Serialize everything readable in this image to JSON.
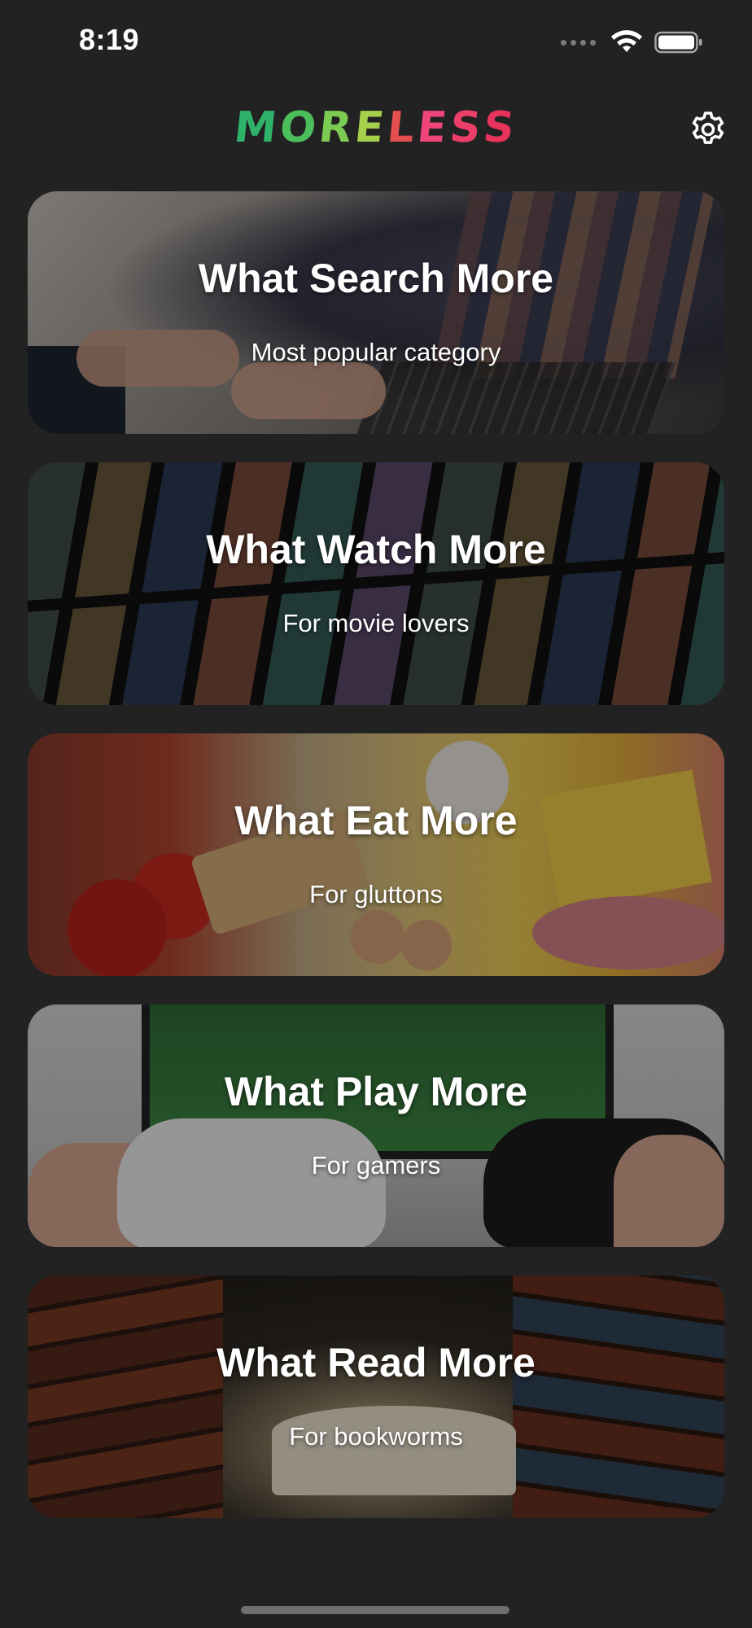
{
  "status_bar": {
    "time": "8:19"
  },
  "header": {
    "logo_letters": [
      {
        "char": "M",
        "color": "#2fb36a"
      },
      {
        "char": "O",
        "color": "#4cbf5c"
      },
      {
        "char": "R",
        "color": "#7ccb52"
      },
      {
        "char": "E",
        "color": "#a6d04c"
      },
      {
        "char": "L",
        "color": "#e44f4f"
      },
      {
        "char": "E",
        "color": "#f0457a"
      },
      {
        "char": "S",
        "color": "#ee3f6a"
      },
      {
        "char": "S",
        "color": "#e8335c"
      }
    ],
    "settings_icon": "gear-icon"
  },
  "categories": [
    {
      "title": "What Search More",
      "subtitle": "Most popular category"
    },
    {
      "title": "What Watch More",
      "subtitle": "For movie lovers"
    },
    {
      "title": "What Eat More",
      "subtitle": "For gluttons"
    },
    {
      "title": "What Play More",
      "subtitle": "For gamers"
    },
    {
      "title": "What Read More",
      "subtitle": "For bookworms"
    }
  ]
}
